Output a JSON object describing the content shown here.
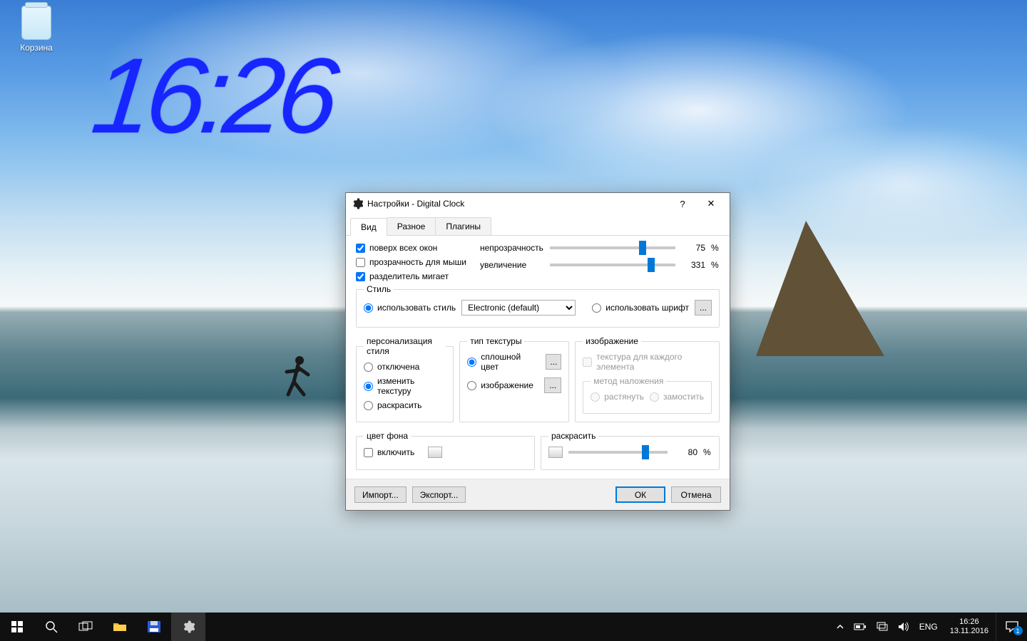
{
  "desktop": {
    "recycle_bin": "Корзина",
    "clock_widget_time": "16:26"
  },
  "dialog": {
    "title": "Настройки - Digital Clock",
    "tabs": {
      "view": "Вид",
      "misc": "Разное",
      "plugins": "Плагины"
    },
    "options": {
      "stay_on_top": "поверх всех окон",
      "mouse_transparency": "прозрачность для мыши",
      "separator_blinks": "разделитель мигает",
      "opacity_label": "непрозрачность",
      "zoom_label": "увеличение",
      "opacity_value": "75",
      "zoom_value": "331",
      "percent": "%"
    },
    "style": {
      "group": "Стиль",
      "use_style": "использовать стиль",
      "use_font": "использовать шрифт",
      "style_selected": "Electronic (default)"
    },
    "personalization": {
      "group": "персонализация стиля",
      "off": "отключена",
      "change_texture": "изменить текстуру",
      "colorize": "раскрасить"
    },
    "texture": {
      "group": "тип текстуры",
      "solid": "сплошной цвет",
      "image": "изображение"
    },
    "image": {
      "group": "изображение",
      "per_element": "текстура для каждого элемента",
      "blend_group": "метод наложения",
      "stretch": "растянуть",
      "tile": "замостить"
    },
    "bg": {
      "group": "цвет фона",
      "enable": "включить"
    },
    "colorize": {
      "group": "раскрасить",
      "value": "80",
      "percent": "%"
    },
    "buttons": {
      "import": "Импорт...",
      "export": "Экспорт...",
      "ok": "ОК",
      "cancel": "Отмена"
    }
  },
  "taskbar": {
    "lang": "ENG",
    "time": "16:26",
    "date": "13.11.2016",
    "notif_count": "1"
  }
}
